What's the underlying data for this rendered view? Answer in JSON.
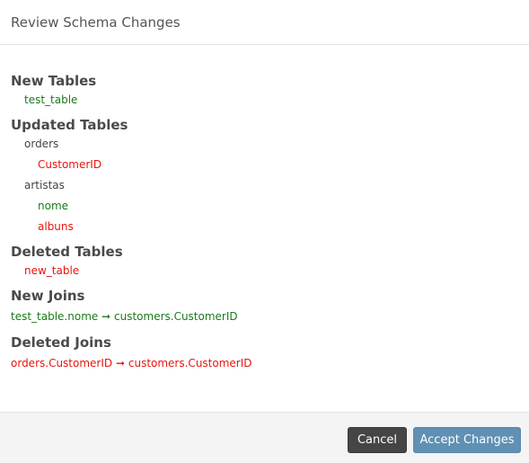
{
  "header": {
    "title": "Review Schema Changes"
  },
  "sections": {
    "new_tables": {
      "title": "New Tables",
      "items": [
        "test_table"
      ]
    },
    "updated_tables": {
      "title": "Updated Tables",
      "tables": [
        {
          "name": "orders",
          "columns": [
            {
              "name": "CustomerID",
              "status": "removed"
            }
          ]
        },
        {
          "name": "artistas",
          "columns": [
            {
              "name": "nome",
              "status": "added"
            },
            {
              "name": "albuns",
              "status": "removed"
            }
          ]
        }
      ]
    },
    "deleted_tables": {
      "title": "Deleted Tables",
      "items": [
        "new_table"
      ]
    },
    "new_joins": {
      "title": "New Joins",
      "items": [
        {
          "from": "test_table.nome",
          "arrow": "➞",
          "to": "customers.CustomerID"
        }
      ]
    },
    "deleted_joins": {
      "title": "Deleted Joins",
      "items": [
        {
          "from": "orders.CustomerID",
          "arrow": "➞",
          "to": "customers.CustomerID"
        }
      ]
    }
  },
  "footer": {
    "cancel_label": "Cancel",
    "accept_label": "Accept Changes"
  },
  "colors": {
    "added": "#1a7a1a",
    "removed": "#e8140e",
    "accept": "#6090b3",
    "cancel": "#454545"
  }
}
